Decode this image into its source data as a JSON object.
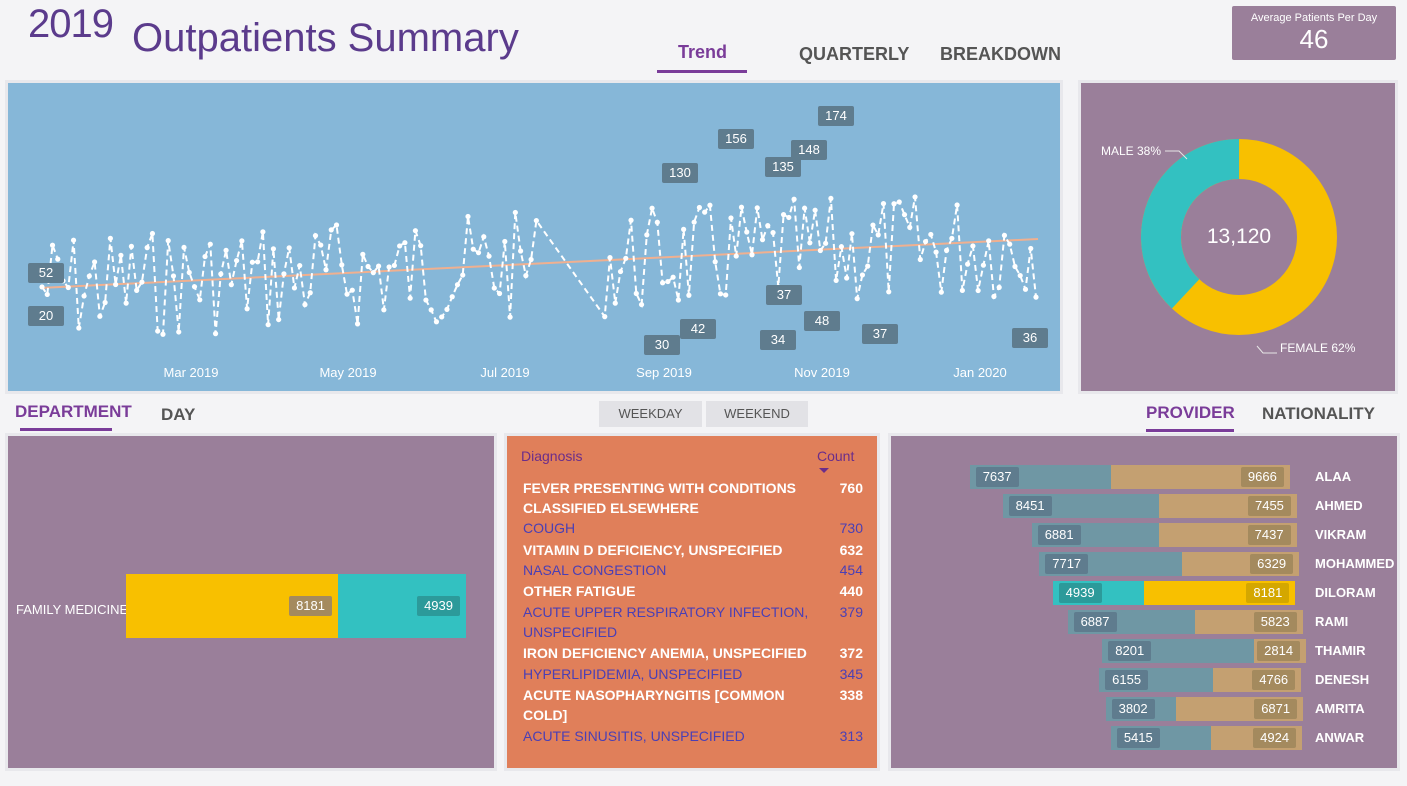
{
  "header": {
    "year": "2019",
    "title": "Outpatients Summary"
  },
  "tabs_top": [
    {
      "label": "Trend",
      "active": true
    },
    {
      "label": "QUARTERLY",
      "active": false
    },
    {
      "label": "BREAKDOWN",
      "active": false
    }
  ],
  "kpi": {
    "label": "Average Patients Per Day",
    "value": "46"
  },
  "trend": {
    "x_ticks": [
      "Mar 2019",
      "May 2019",
      "Jul 2019",
      "Sep 2019",
      "Nov 2019",
      "Jan 2020"
    ],
    "labels": [
      "52",
      "20",
      "130",
      "156",
      "135",
      "148",
      "174",
      "30",
      "42",
      "37",
      "34",
      "48",
      "37",
      "36"
    ]
  },
  "gender": {
    "total": "13,120",
    "male_label": "MALE 38%",
    "female_label": "FEMALE 62%",
    "colors": {
      "male": "#33c1c1",
      "female": "#f8c000"
    }
  },
  "tabs_left": [
    {
      "label": "DEPARTMENT",
      "active": true
    },
    {
      "label": "DAY",
      "active": false
    }
  ],
  "day_buttons": [
    "WEEKDAY",
    "WEEKEND"
  ],
  "department": {
    "name": "FAMILY MEDICINE",
    "female": "8181",
    "male": "4939"
  },
  "diagnosis": {
    "header_name": "Diagnosis",
    "header_count": "Count",
    "rows": [
      {
        "name": "FEVER PRESENTING WITH CONDITIONS CLASSIFIED ELSEWHERE",
        "count": "760"
      },
      {
        "name": "COUGH",
        "count": "730"
      },
      {
        "name": "VITAMIN D DEFICIENCY, UNSPECIFIED",
        "count": "632"
      },
      {
        "name": "NASAL CONGESTION",
        "count": "454"
      },
      {
        "name": "OTHER FATIGUE",
        "count": "440"
      },
      {
        "name": "ACUTE UPPER RESPIRATORY INFECTION, UNSPECIFIED",
        "count": "379"
      },
      {
        "name": "IRON DEFICIENCY ANEMIA, UNSPECIFIED",
        "count": "372"
      },
      {
        "name": "HYPERLIPIDEMIA, UNSPECIFIED",
        "count": "345"
      },
      {
        "name": "ACUTE NASOPHARYNGITIS [COMMON COLD]",
        "count": "338"
      },
      {
        "name": "ACUTE SINUSITIS, UNSPECIFIED",
        "count": "313"
      }
    ]
  },
  "tabs_right": [
    {
      "label": "PROVIDER",
      "active": true
    },
    {
      "label": "NATIONALITY",
      "active": false
    }
  ],
  "providers": [
    {
      "name": "ALAA",
      "male": "7637",
      "female": "9666"
    },
    {
      "name": "AHMED",
      "male": "8451",
      "female": "7455"
    },
    {
      "name": "VIKRAM",
      "male": "6881",
      "female": "7437"
    },
    {
      "name": "MOHAMMED",
      "male": "7717",
      "female": "6329"
    },
    {
      "name": "DILORAM",
      "male": "4939",
      "female": "8181"
    },
    {
      "name": "RAMI",
      "male": "6887",
      "female": "5823"
    },
    {
      "name": "THAMIR",
      "male": "8201",
      "female": "2814"
    },
    {
      "name": "DENESH",
      "male": "6155",
      "female": "4766"
    },
    {
      "name": "AMRITA",
      "male": "3802",
      "female": "6871"
    },
    {
      "name": "ANWAR",
      "male": "5415",
      "female": "4924"
    }
  ]
}
